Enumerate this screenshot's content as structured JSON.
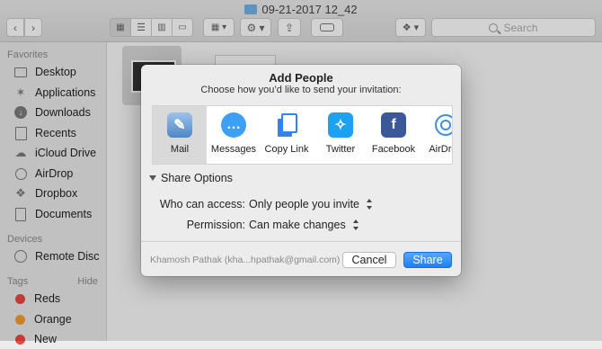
{
  "window": {
    "title": "09-21-2017 12_42",
    "search_placeholder": "Search"
  },
  "sidebar": {
    "favorites_header": "Favorites",
    "favorites": [
      {
        "label": "Desktop",
        "icon": "desktop-icon"
      },
      {
        "label": "Applications",
        "icon": "applications-icon"
      },
      {
        "label": "Downloads",
        "icon": "downloads-icon"
      },
      {
        "label": "Recents",
        "icon": "recents-icon"
      },
      {
        "label": "iCloud Drive",
        "icon": "icloud-icon"
      },
      {
        "label": "AirDrop",
        "icon": "airdrop-icon"
      },
      {
        "label": "Dropbox",
        "icon": "dropbox-icon"
      },
      {
        "label": "Documents",
        "icon": "documents-icon"
      }
    ],
    "devices_header": "Devices",
    "devices": [
      {
        "label": "Remote Disc",
        "icon": "disc-icon"
      }
    ],
    "tags_header": "Tags",
    "tags_hide": "Hide",
    "tags": [
      {
        "label": "Reds",
        "color": "#e9463f"
      },
      {
        "label": "Orange",
        "color": "#f39a2b"
      },
      {
        "label": "New",
        "color": "#e9463f"
      }
    ]
  },
  "dialog": {
    "title": "Add People",
    "subtitle": "Choose how you’d like to send your invitation:",
    "apps": [
      {
        "label": "Mail",
        "icon": "mail-icon",
        "color": "#6a9fd6",
        "selected": true
      },
      {
        "label": "Messages",
        "icon": "messages-icon",
        "color": "#3da0f5",
        "selected": false
      },
      {
        "label": "Copy Link",
        "icon": "copy-link-icon",
        "color": "#2f85ef",
        "selected": false
      },
      {
        "label": "Twitter",
        "icon": "twitter-icon",
        "color": "#1da1f2",
        "selected": false
      },
      {
        "label": "Facebook",
        "icon": "facebook-icon",
        "color": "#3b5998",
        "selected": false
      },
      {
        "label": "AirDrop",
        "icon": "airdrop-icon",
        "color": "#3a8ef0",
        "selected": false
      }
    ],
    "share_options_label": "Share Options",
    "who_can_access_label": "Who can access:",
    "who_can_access_value": "Only people you invite",
    "permission_label": "Permission:",
    "permission_value": "Can make changes",
    "account": "Khamosh Pathak (kha...hpathak@gmail.com)",
    "cancel_label": "Cancel",
    "share_label": "Share",
    "accent": "#1d7ef5"
  }
}
